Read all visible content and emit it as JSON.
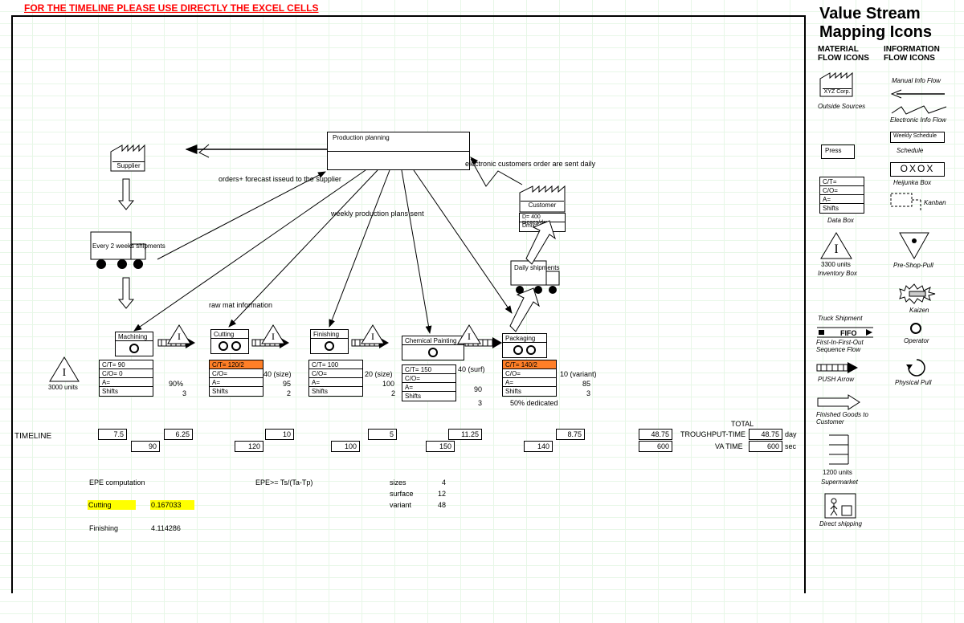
{
  "warning": "FOR THE TIMELINE PLEASE USE DIRECTLY THE EXCEL CELLS",
  "title": "Value Stream Mapping Icons",
  "cols": {
    "mat": "MATERIAL FLOW ICONS",
    "info": "INFORMATION FLOW ICONS"
  },
  "supplier": {
    "name": "Supplier",
    "shipment": "Every 2 weeks shipments"
  },
  "planning": "Production planning",
  "annot": {
    "ordersForecast": "orders+ forecast isseud to the supplier",
    "weeklyPlans": "weekly production plans sent",
    "electronic": "electronic customers order are sent daily",
    "rawMat": "raw mat information"
  },
  "customer": {
    "name": "Customer",
    "demand": "D= 400 pieces/day",
    "dmix": "Dmix=",
    "daily": "Daily shipments"
  },
  "inventory0": {
    "units": "3000 units"
  },
  "proc": {
    "machining": {
      "name": "Machining",
      "ct": "C/T= 90",
      "co": "C/O= 0",
      "a": "A=",
      "av": "90%",
      "sh": "Shifts",
      "shv": "3"
    },
    "cutting": {
      "name": "Cutting",
      "ct": "C/T= 120/2",
      "co": "C/O=",
      "cov": "40 (size)",
      "a": "A=",
      "av": "95",
      "sh": "Shifts",
      "shv": "2"
    },
    "finishing": {
      "name": "Finishing",
      "ct": "C/T= 100",
      "co": "C/O=",
      "cov": "20 (size)",
      "a": "A=",
      "av": "100",
      "sh": "Shifts",
      "shv": "2"
    },
    "chemical": {
      "name": "Chemical Painting",
      "ct": "C/T= 150",
      "co": "C/O=",
      "cov": "40 (surf)",
      "a": "A=",
      "av": "90",
      "sh": "Shifts",
      "shv": "3"
    },
    "packaging": {
      "name": "Packaging",
      "ct": "C/T= 140/2",
      "co": "C/O=",
      "cov": "10 (variant)",
      "a": "A=",
      "av": "85",
      "sh": "Shifts",
      "shv": "3",
      "dedicated": "50% dedicated"
    }
  },
  "timeline": {
    "label": "TIMELINE",
    "top": [
      "7.5",
      "6.25",
      "10",
      "5",
      "11.25",
      "8.75",
      "48.75"
    ],
    "bot": [
      "90",
      "120",
      "100",
      "150",
      "140",
      "600"
    ],
    "total": "TOTAL",
    "throughput": "TROUGHPUT-TIME",
    "throughputUnit": "day",
    "vatime": "VA TIME",
    "vatimeUnit": "sec"
  },
  "epe": {
    "label": "EPE computation",
    "formula": "EPE>= Ts/(Ta-Tp)",
    "cutting": "Cutting",
    "cuttingVal": "0.167033",
    "finishing": "Finishing",
    "finishingVal": "4.114286",
    "sizes": "sizes",
    "sizesV": "4",
    "surface": "surface",
    "surfaceV": "12",
    "variant": "variant",
    "variantV": "48"
  },
  "legend": {
    "xyz": "XYZ Corp.",
    "outside": "Outside Sources",
    "manual": "Manual Info Flow",
    "elec": "Electronic Info Flow",
    "press": "Press",
    "schedule": "Schedule",
    "weekly": "Weekly Schedule",
    "heijunka": "Heijunka Box",
    "heijunkaTxt": "OXOX",
    "ct": "C/T=",
    "co": "C/O=",
    "a": "A=",
    "sh": "Shifts",
    "databox": "Data Box",
    "kanban": "Kanban",
    "inventory": "3300 units",
    "invbox": "Inventory Box",
    "preshop": "Pre-Shop-Pull",
    "kaizen": "Kaizen",
    "truck": "Truck Shipment",
    "operator": "Operator",
    "fifo": "FIFO",
    "fifoTxt": "First-In-First-Out Sequence Flow",
    "push": "PUSH Arrow",
    "physical": "Physical Pull",
    "finished": "Finished Goods to Customer",
    "supermarket": "Supermarket",
    "supermarketUnits": "1200 units",
    "direct": "Direct shipping"
  }
}
